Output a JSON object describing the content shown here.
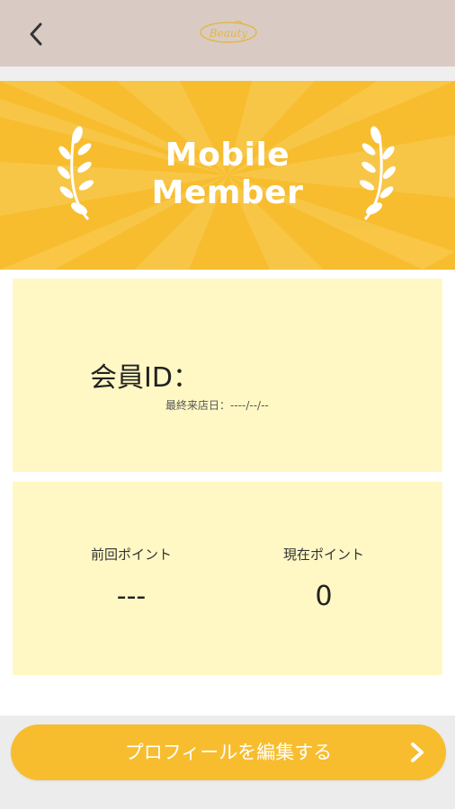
{
  "header": {
    "back_icon": "chevron-left-icon",
    "logo_text": "Beauty"
  },
  "banner": {
    "title_line1": "Mobile",
    "title_line2": "Member",
    "background_color": "#f7bd2f",
    "decoration_icon": "laurel-icon"
  },
  "member": {
    "id_label": "会員ID：",
    "last_visit": "最終来店日：----/--/--"
  },
  "points": {
    "previous_label": "前回ポイント",
    "previous_value": "---",
    "current_label": "現在ポイント",
    "current_value": "0"
  },
  "actions": {
    "edit_profile_label": "プロフィールを編集する",
    "edit_profile_icon": "chevron-right-icon",
    "accent_color": "#f7bd2f"
  }
}
